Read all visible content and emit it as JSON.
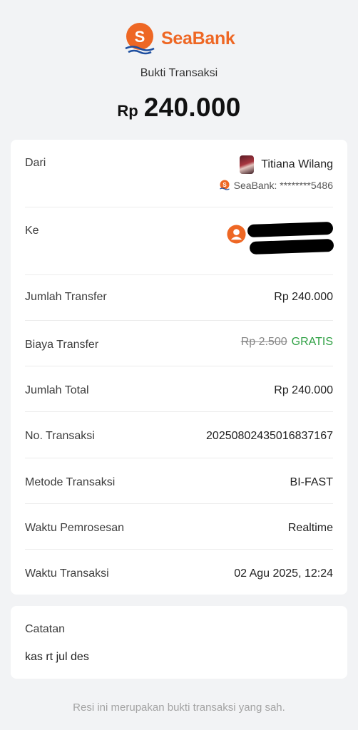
{
  "brand": {
    "name": "SeaBank",
    "color": "#ee6724"
  },
  "header": {
    "subtitle": "Bukti Transaksi",
    "amount_currency": "Rp",
    "amount_value": "240.000"
  },
  "from": {
    "label": "Dari",
    "name": "Titiana Wilang",
    "account": "SeaBank: ********5486"
  },
  "to": {
    "label": "Ke",
    "icon": "user-circle-icon"
  },
  "details": [
    {
      "label": "Jumlah Transfer",
      "value": "Rp 240.000"
    },
    {
      "label": "Biaya Transfer",
      "original": "Rp 2.500",
      "value": "GRATIS"
    },
    {
      "label": "Jumlah Total",
      "value": "Rp 240.000"
    },
    {
      "label": "No. Transaksi",
      "value": "20250802435016837167"
    },
    {
      "label": "Metode Transaksi",
      "value": "BI-FAST"
    },
    {
      "label": "Waktu Pemrosesan",
      "value": "Realtime"
    },
    {
      "label": "Waktu Transaksi",
      "value": "02 Agu 2025, 12:24"
    }
  ],
  "note": {
    "label": "Catatan",
    "value": "kas rt jul des"
  },
  "footer": "Resi ini merupakan bukti transaksi yang sah.",
  "colors": {
    "free": "#2ea043",
    "accent": "#ee6724"
  }
}
